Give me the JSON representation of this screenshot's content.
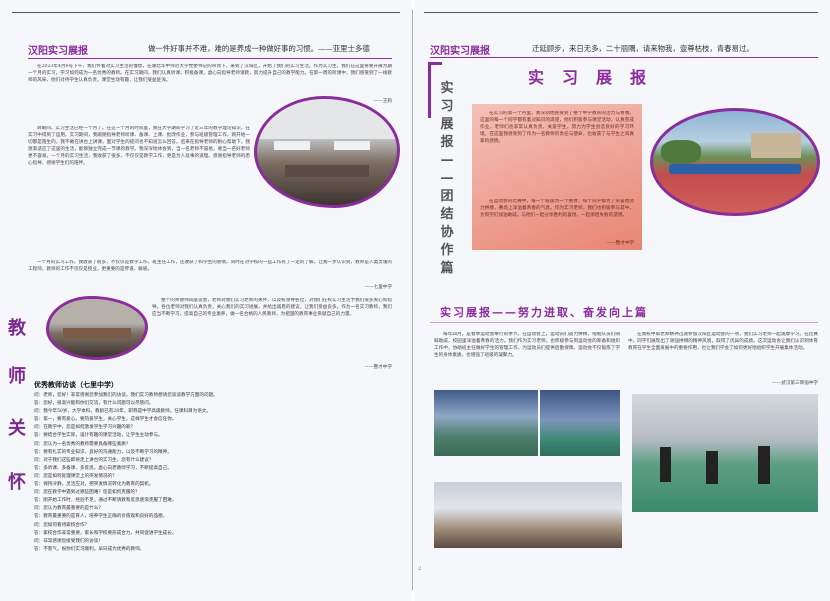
{
  "left": {
    "tag": "汉阳实习展报",
    "slogan": "做一件好事并不难，难的是养成一种做好事的习惯。——亚里士多德",
    "para1": "在2023年4月6号下午，我们怀着对实习生活的憧憬，在湖北华中师范大学党委书记的带领下，来到了汉阳区，开始了我们的实习生活。作为实习生，我们在这里将要开展为期一个月的实习，学习如何成为一名优秀的教师。在实习期间，我们认真听课，积极备课，虚心向指导老师请教，努力提升自己的教学能力。在第一周的听课中，我们感受到了一线教师的风采，他们对待学生认真负责，课堂生动有趣，让我们受益匪浅。",
    "sign1": "——王莉",
    "para2": "转眼间，实习生活已经一个月了。在这一个月的时间里，我在大学期间学习了近三年的教学理论知识，在实习中得到了运用。实习期间，我跟随指导老师听课、备课、上课、批改作业，参与班级管理工作。刚开始一切都是陌生的，我不敢在讲台上讲课，面对学生的提问也不知道怎么回答。后来在指导老师的耐心帮助下，我逐渐适应了这里的生活，能够独立完成一节课的教学。我深深地体会到，当一名老师不容易，要当一名好老师更不容易。一个月的实习生活，我收获了很多，不仅仅是教学工作，更是为人处事的道理。感谢指导老师的悉心指导，感谢学生们的陪伴。",
    "para3": "一个月的实习工作，我收获了很多，不仅仅是教学工作，班主任工作，还收获了和学生的感情。同时在对学校的一些工作有了一定的了解，让我一步认识到，教师是人类灵魂的工程师，教师的工作不仅仅是授业，更重要的是传道、解惑。",
    "sign2": "——七里中学",
    "vertical_title": [
      "教",
      "师",
      "关",
      "怀"
    ],
    "para4": "整个的师德师风座谈会，老师对我们实习老师的关怀，以及校领导各位，对我们在校实习生活予我们很多关心和指导。各位老师对我们认真负责，关心我们的实习进展，并给出诚恳的建议，让我们受益良多。作为一名实习教师，我们应当不断学习，提高自己的专业素养，做一名合格的人民教师，为祖国的教育事业贡献自己的力量。",
    "sign4": "——整才中学",
    "qa_title": "优秀教师访谈（七里中学）",
    "qa_lines": [
      "问：老师，您好！非常感谢您参加我们的访谈，我们实习教师想请您谈谈教学方面的问题。",
      "答：您好，很高兴能和你们交流，有什么问题可以尽管问。",
      "问：我今年50岁，大学本科，教龄已有28年，职称是中学高级教师，任课科目为语文。",
      "答：第一，要有爱心，要热爱学生，关心学生，这样学生才会信任你。",
      "问：在教学中，您是如何激发学生学习兴趣的呢？",
      "答：要结合学生实际，设计有趣的课堂活动，让学生主动参与。",
      "问：您认为一名优秀的教师需要具备哪些素质？",
      "答：要有扎实的专业知识、良好的沟通能力，以及不断学习的精神。",
      "问：对于我们这些即将走上讲台的实习生，您有什么建议？",
      "答：多听课、多备课、多反思，虚心向老教师学习，不断提高自己。",
      "问：您是如何处理课堂上的突发情况的？",
      "答：保持冷静，灵活应对，把突发情况转化为教育的契机。",
      "问：您在教学中遇到过哪些困难？您是如何克服的？",
      "答：刚开始工作时，经验不足，通过不断请教和反思逐渐克服了困难。",
      "问：您认为教育最重要的是什么？",
      "答：教育最重要的是育人，培养学生正确的价值观和良好的品德。",
      "问：您如何看待家校合作？",
      "答：家校合作非常重要，家长和学校要形成合力，共同促进学生成长。",
      "问：非常感谢您接受我们的访谈！",
      "答：不客气，祝你们实习顺利，早日成为优秀的教师。"
    ]
  },
  "right": {
    "tag": "汉阳实习展报",
    "slogan": "迁延顾步，来日无多，二十丽隅，请来物我，壹尊枯枝，青春易过。",
    "big_title": "实习展报",
    "vertical_title": [
      "实",
      "习",
      "展",
      "报",
      "—",
      "—",
      "团",
      "结",
      "协",
      "作",
      "篇"
    ],
    "red_para1": "在实习的第一个月里，我深刻地感受到了整个中学教育的活力与青春。这里的每一个同学都有着对知识的渴望，他们积极参与课堂活动，认真完成作业。老师们也非常认真负责，关爱学生，努力为学生创造良好的学习环境。在这里我感受到了作为一名教师的责任与使命，也收获了与学生之间真挚的感情。",
    "red_para2": "在运动会的比赛中，每一个班级为一个整体，每个同学都为了荣誉而努力拼搏，赛场上洋溢着青春的气息。作为实习老师，我们也积极参与其中，为同学们加油助威，与他们一起分享胜利的喜悦，一起承担失败的遗憾。",
    "red_sign": "——整才中学",
    "sub_title": "实习展报——努力进取、奋发向上篇",
    "para5": "每年四月，是春季运动会举行的季节。在运动会上，运动员们奋力拼搏，啦啦队员们呐喊助威，校园里洋溢着青春的活力。我们作为实习老师，也积极参与到运动会的筹备和组织工作中，协助班主任做好学生的管理工作，为运动员们提供后勤保障。运动会不仅锻炼了学生的身体素质，也增强了班级的凝聚力。",
    "para6": "在我校中职老师精神迅速参加汉阳区运动会的一项，我们实习老师一起观摩学习。在比赛中，同学们展现出了顽强拼搏的精神风貌，取得了优异的成绩。这次运动会让我们认识到体育教育在学生全面发展中的重要作用，也让我们学会了如何更好地组织学生开展集体活动。",
    "sign6": "——武汉第三寄宿中学",
    "page_number": "2"
  },
  "colors": {
    "accent": "#8a2c9c",
    "red_box": "#e88574"
  }
}
